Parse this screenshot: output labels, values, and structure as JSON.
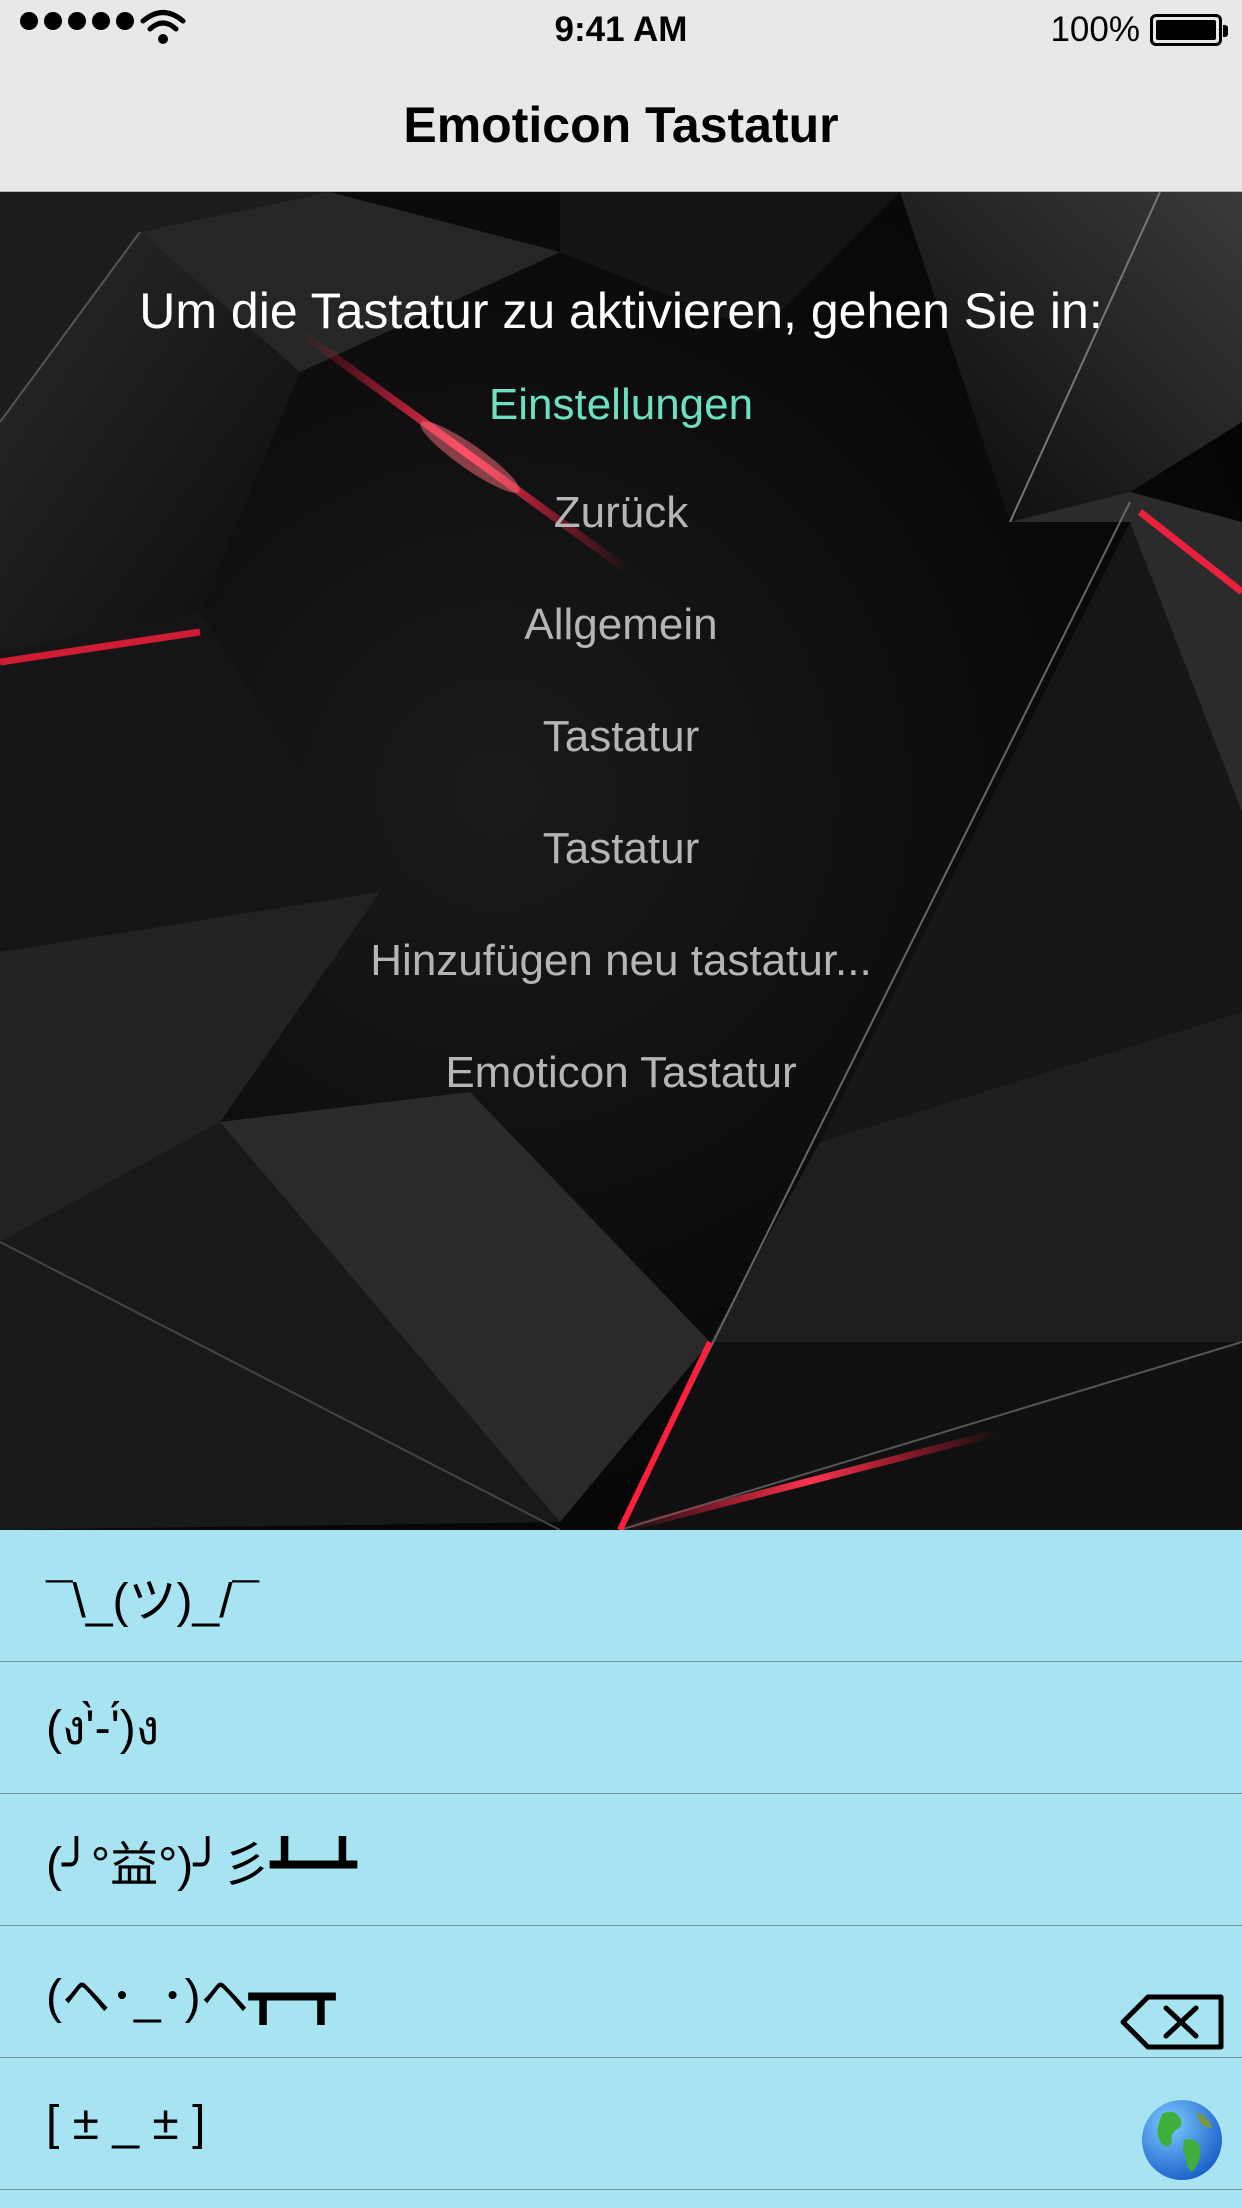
{
  "status_bar": {
    "time": "9:41 AM",
    "battery_text": "100%"
  },
  "nav": {
    "title": "Emoticon Tastatur"
  },
  "instructions": {
    "title": "Um die Tastatur zu aktivieren, gehen Sie in:",
    "link_label": "Einstellungen",
    "steps": [
      "Zurück",
      "Allgemein",
      "Tastatur",
      "Tastatur",
      "Hinzufügen neu tastatur...",
      "Emoticon Tastatur"
    ],
    "link_color": "#6ee0c2"
  },
  "keyboard": {
    "background": "#a8e3f2",
    "emoticons": [
      "¯\\_(ツ)_/¯",
      "(ง'̀-'́)ง",
      "(╯°益°)╯彡┻━┻",
      "(ヘ･_･)ヘ┳━┳",
      "[ ± _ ± ]"
    ],
    "icons": [
      "backspace-icon",
      "globe-icon"
    ]
  }
}
